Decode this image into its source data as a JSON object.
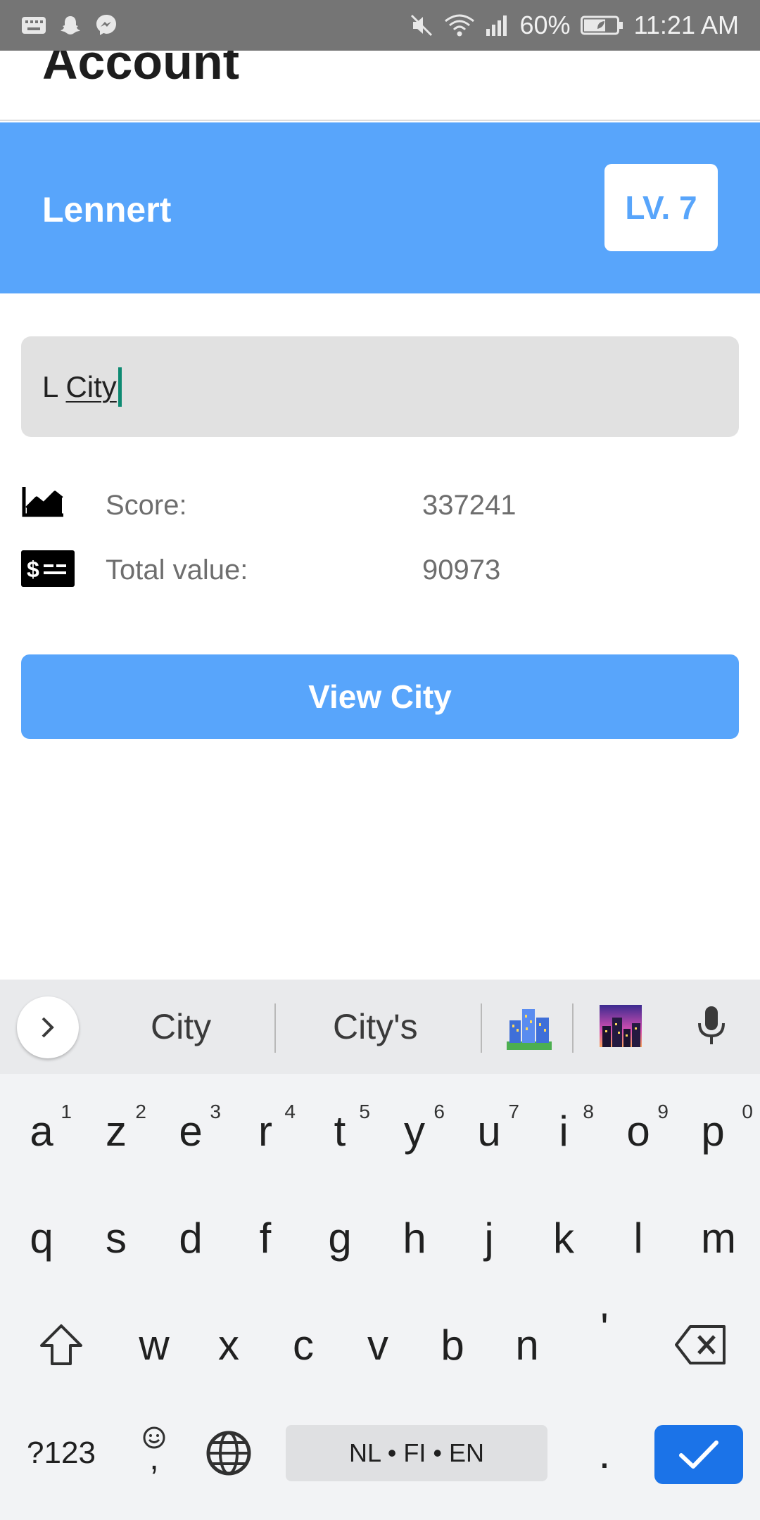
{
  "status_bar": {
    "battery": "60%",
    "time": "11:21 AM",
    "left_icons": [
      "keyboard-icon",
      "snapchat-icon",
      "messenger-icon"
    ],
    "right_icons": [
      "mute-icon",
      "wifi-icon",
      "signal-icon",
      "battery-icon"
    ]
  },
  "app_bar": {
    "title": "Account"
  },
  "profile": {
    "name": "Lennert",
    "level": "LV. 7"
  },
  "city_input": {
    "prefix": "L ",
    "word": "City"
  },
  "stats": [
    {
      "icon": "trending-up-icon",
      "label": "Score:",
      "value": "337241"
    },
    {
      "icon": "money-bill-icon",
      "label": "Total value:",
      "value": "90973"
    }
  ],
  "view_city_button": {
    "label": "View City"
  },
  "keyboard": {
    "suggestions": [
      "City",
      "City's"
    ],
    "emoji_suggestions": [
      "cityscape-emoji",
      "city-dusk-emoji"
    ],
    "rows": [
      [
        "a",
        "z",
        "e",
        "r",
        "t",
        "y",
        "u",
        "i",
        "o",
        "p"
      ],
      [
        "q",
        "s",
        "d",
        "f",
        "g",
        "h",
        "j",
        "k",
        "l",
        "m"
      ],
      [
        "w",
        "x",
        "c",
        "v",
        "b",
        "n",
        "'"
      ]
    ],
    "number_hints": [
      "1",
      "2",
      "3",
      "4",
      "5",
      "6",
      "7",
      "8",
      "9",
      "0"
    ],
    "symbols_key": "?123",
    "comma_key": ",",
    "period_key": ".",
    "space_label": "NL • FI • EN"
  },
  "colors": {
    "accent": "#58a5fb",
    "status_bar": "#757575",
    "enter_key": "#1b73e8",
    "caret": "#0e8a72"
  }
}
